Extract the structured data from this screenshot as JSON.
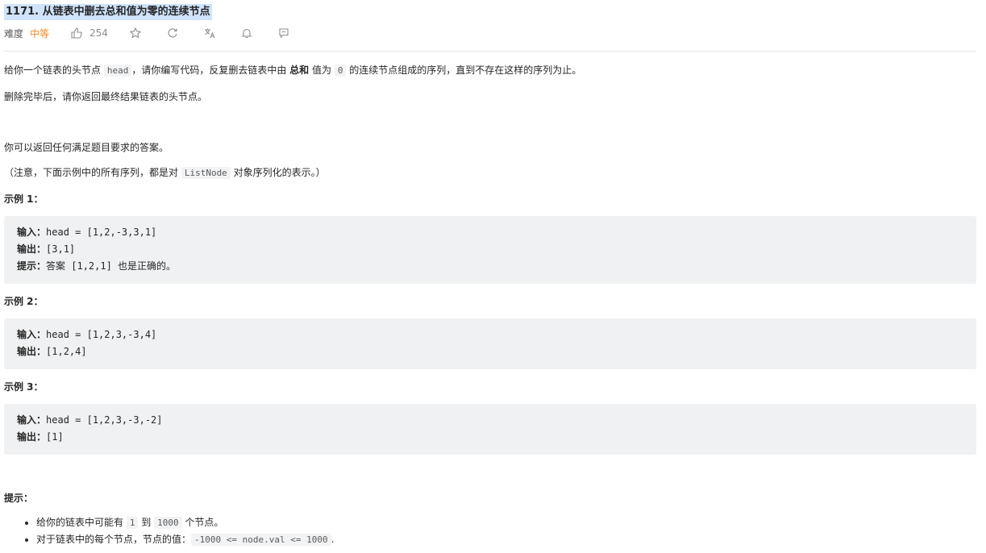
{
  "problem": {
    "title": "1171. 从链表中删去总和值为零的连续节点",
    "difficulty_label": "难度",
    "difficulty_value": "中等",
    "like_count": "254"
  },
  "description": {
    "p1_a": "给你一个链表的头节点 ",
    "p1_code": "head",
    "p1_b": "，请你编写代码，反复删去链表中由 ",
    "p1_bold": "总和",
    "p1_c": " 值为 ",
    "p1_code2": "0",
    "p1_d": " 的连续节点组成的序列，直到不存在这样的序列为止。",
    "p2": "删除完毕后，请你返回最终结果链表的头节点。",
    "p3": "你可以返回任何满足题目要求的答案。",
    "p4_a": "（注意，下面示例中的所有序列，都是对 ",
    "p4_code": "ListNode",
    "p4_b": " 对象序列化的表示。）"
  },
  "examples": [
    {
      "heading": "示例 1：",
      "input_label": "输入：",
      "input": "head = [1,2,-3,3,1]",
      "output_label": "输出：",
      "output": "[3,1]",
      "hint_label": "提示：",
      "hint": "答案 [1,2,1] 也是正确的。"
    },
    {
      "heading": "示例 2：",
      "input_label": "输入：",
      "input": "head = [1,2,3,-3,4]",
      "output_label": "输出：",
      "output": "[1,2,4]"
    },
    {
      "heading": "示例 3：",
      "input_label": "输入：",
      "input": "head = [1,2,3,-3,-2]",
      "output_label": "输出：",
      "output": "[1]"
    }
  ],
  "constraints": {
    "heading": "提示：",
    "c1_a": "给你的链表中可能有 ",
    "c1_code1": "1",
    "c1_b": " 到 ",
    "c1_code2": "1000",
    "c1_c": " 个节点。",
    "c2_a": "对于链表中的每个节点，节点的值：",
    "c2_code": "-1000 <= node.val <= 1000",
    "c2_b": "."
  },
  "icons": [
    "thumbs-up-icon",
    "star-icon",
    "refresh-icon",
    "translate-icon",
    "bell-icon",
    "comment-icon"
  ]
}
